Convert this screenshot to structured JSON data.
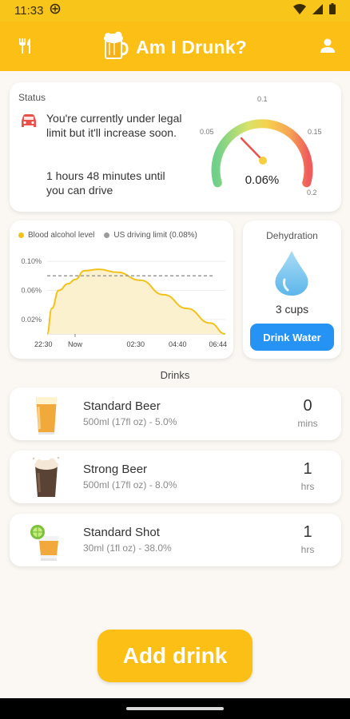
{
  "statusbar": {
    "time": "11:33"
  },
  "appbar": {
    "title": "Am I Drunk?"
  },
  "status": {
    "label": "Status",
    "message": "You're currently under legal limit but it'll increase soon.",
    "wait": "1 hours 48 minutes until you can drive"
  },
  "gauge": {
    "value": 0.06,
    "value_text": "0.06%",
    "ticks": [
      "0.05",
      "0.1",
      "0.15",
      "0.2"
    ],
    "min": 0.0,
    "max": 0.2
  },
  "chart_data": {
    "type": "area",
    "legend": [
      "Blood alcohol level",
      "US driving limit (0.08%)"
    ],
    "x_tick_labels": [
      "22:30",
      "Now",
      "02:30",
      "04:40",
      "06:44"
    ],
    "y_tick_labels": [
      "0.02%",
      "0.06%",
      "0.10%"
    ],
    "ylim": [
      0.0,
      0.11
    ],
    "series": [
      {
        "name": "Blood alcohol level",
        "x": [
          0.0,
          0.2,
          0.5,
          0.9,
          1.2,
          1.6,
          2.2,
          3.0,
          4.0,
          5.0,
          6.0,
          7.0,
          7.65
        ],
        "values": [
          0.0,
          0.035,
          0.06,
          0.069,
          0.075,
          0.087,
          0.089,
          0.085,
          0.074,
          0.054,
          0.035,
          0.015,
          0.0
        ]
      },
      {
        "name": "US driving limit (0.08%)",
        "values": [
          0.08
        ]
      }
    ],
    "x_unit_note": "hours",
    "colors": {
      "bac": "#f2c21b",
      "bac_fill": "#fbf1cf",
      "limit": "#9b9b9b"
    }
  },
  "dehydration": {
    "title": "Dehydration",
    "cups": "3 cups",
    "button": "Drink Water"
  },
  "drinks": {
    "heading": "Drinks",
    "items": [
      {
        "name": "Standard Beer",
        "desc": "500ml (17fl oz) - 5.0%",
        "value": "0",
        "unit": "mins"
      },
      {
        "name": "Strong Beer",
        "desc": "500ml (17fl oz) - 8.0%",
        "value": "1",
        "unit": "hrs"
      },
      {
        "name": "Standard Shot",
        "desc": "30ml (1fl oz) - 38.0%",
        "value": "1",
        "unit": "hrs"
      }
    ]
  },
  "add_button": {
    "label": "Add drink"
  },
  "colors": {
    "primary": "#fbbf16",
    "water": "#2493f3",
    "background": "#fbf8f3"
  }
}
